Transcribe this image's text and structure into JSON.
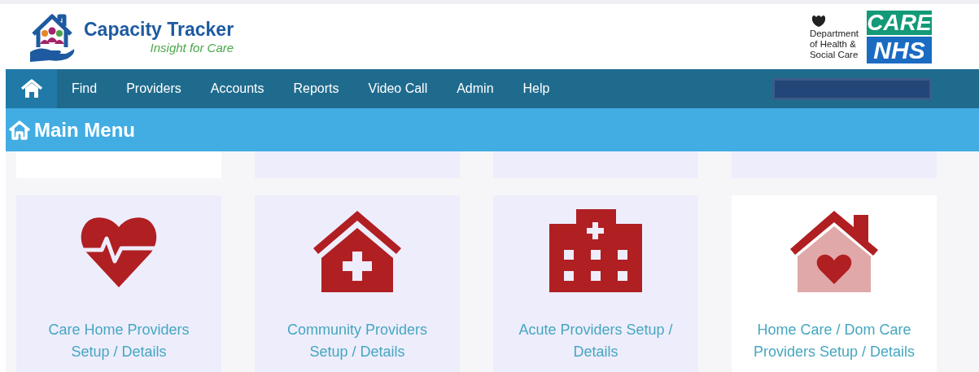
{
  "brand": {
    "title": "Capacity Tracker",
    "tagline": "Insight for Care"
  },
  "partner": {
    "department": "Department\nof Health &\nSocial Care",
    "care_badge": "CARE",
    "nhs_badge": "NHS"
  },
  "nav": [
    {
      "kind": "home",
      "selected": true
    },
    {
      "kind": "link",
      "label": "Find",
      "selected": false
    },
    {
      "kind": "link",
      "label": "Providers",
      "selected": false
    },
    {
      "kind": "link",
      "label": "Accounts",
      "selected": false
    },
    {
      "kind": "link",
      "label": "Reports",
      "selected": false
    },
    {
      "kind": "link",
      "label": "Video Call",
      "selected": false
    },
    {
      "kind": "link",
      "label": "Admin",
      "selected": false
    },
    {
      "kind": "link",
      "label": "Help",
      "selected": false
    }
  ],
  "page_title": "Main Menu",
  "top_cards": [
    {
      "color": "#ffffff"
    },
    {
      "color": "#eeedfc"
    },
    {
      "color": "#eeedfc"
    },
    {
      "color": "#eeedfc"
    }
  ],
  "cards": [
    {
      "kind": "care-home",
      "label": "Care Home Providers\nSetup / Details",
      "hovered": false
    },
    {
      "kind": "community",
      "label": "Community Providers\nSetup / Details",
      "hovered": false
    },
    {
      "kind": "acute",
      "label": "Acute Providers Setup /\nDetails",
      "hovered": false
    },
    {
      "kind": "home-care",
      "label": "Home Care / Dom Care\nProviders Setup / Details",
      "hovered": true
    }
  ]
}
